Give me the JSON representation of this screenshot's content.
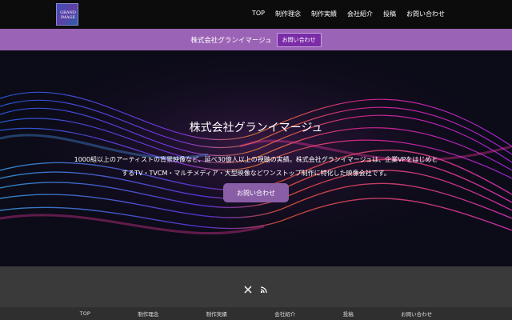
{
  "header": {
    "logo_line1": "GRAND",
    "logo_line2": "IMAGE",
    "nav": [
      "TOP",
      "制作理念",
      "制作実績",
      "会社紹介",
      "投稿",
      "お問い合わせ"
    ]
  },
  "announcement": {
    "text": "株式会社グランイマージュ",
    "button": "お問い合わせ"
  },
  "hero": {
    "title": "株式会社グランイマージュ",
    "desc_line1": "1000組以上のアーティストの背景映像など、延べ30億人以上の視聴の実績。株式会社グランイマージュは、企業VPをはじめと",
    "desc_line2": "するTV・TVCM・マルチメディア・大型映像などワンストップ制作に特化した映像会社です。",
    "button": "お問い合わせ"
  },
  "footer": {
    "social_icons": [
      "x-icon",
      "rss-icon"
    ],
    "nav": [
      "TOP",
      "制作理念",
      "制作実績",
      "会社紹介",
      "投稿",
      "お問い合わせ"
    ]
  },
  "colors": {
    "announcement_bg": "#9b63b5",
    "announcement_btn": "#7b2ca7",
    "hero_btn": "#8a5ea7",
    "footer_bg": "#3a3a3a"
  }
}
